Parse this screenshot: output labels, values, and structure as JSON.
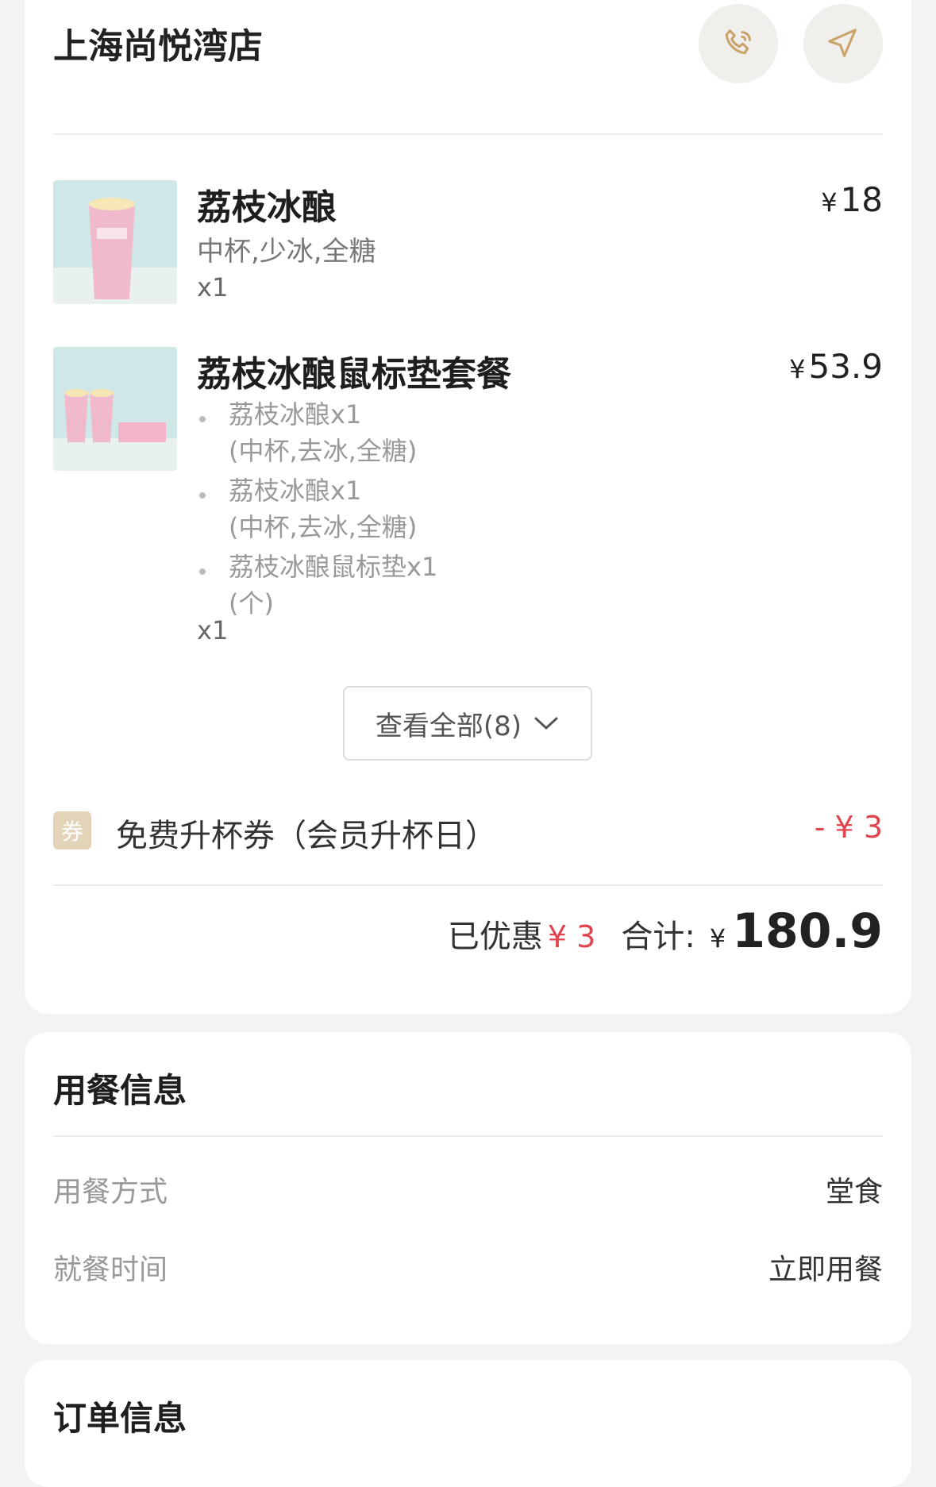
{
  "store": {
    "name": "上海尚悦湾店"
  },
  "icons": {
    "phone": "phone-icon",
    "navigate": "navigate-icon"
  },
  "items": [
    {
      "name": "荔枝冰酿",
      "currency": "¥",
      "price": "18",
      "spec": "中杯,少冰,全糖",
      "qty": "x1"
    },
    {
      "name": "荔枝冰酿鼠标垫套餐",
      "currency": "¥",
      "price": "53.9",
      "qty": "x1",
      "sub_items": [
        {
          "name": "荔枝冰酿x1",
          "spec": "(中杯,去冰,全糖)"
        },
        {
          "name": "荔枝冰酿x1",
          "spec": "(中杯,去冰,全糖)"
        },
        {
          "name": "荔枝冰酿鼠标垫x1",
          "spec": "(个)"
        }
      ]
    }
  ],
  "view_all": {
    "label": "查看全部(8)"
  },
  "coupon": {
    "badge": "券",
    "name": "免费升杯券（会员升杯日）",
    "amount": "- ¥ 3"
  },
  "summary": {
    "discount_label": "已优惠",
    "discount": "¥ 3",
    "total_label": "合计:",
    "currency": "¥",
    "total": "180.9"
  },
  "dining": {
    "title": "用餐信息",
    "rows": [
      {
        "label": "用餐方式",
        "value": "堂食"
      },
      {
        "label": "就餐时间",
        "value": "立即用餐"
      }
    ]
  },
  "order": {
    "title": "订单信息"
  },
  "colors": {
    "accent_red": "#e0444f",
    "icon_gold": "#c9a36a",
    "badge": "#e3d3b8"
  }
}
